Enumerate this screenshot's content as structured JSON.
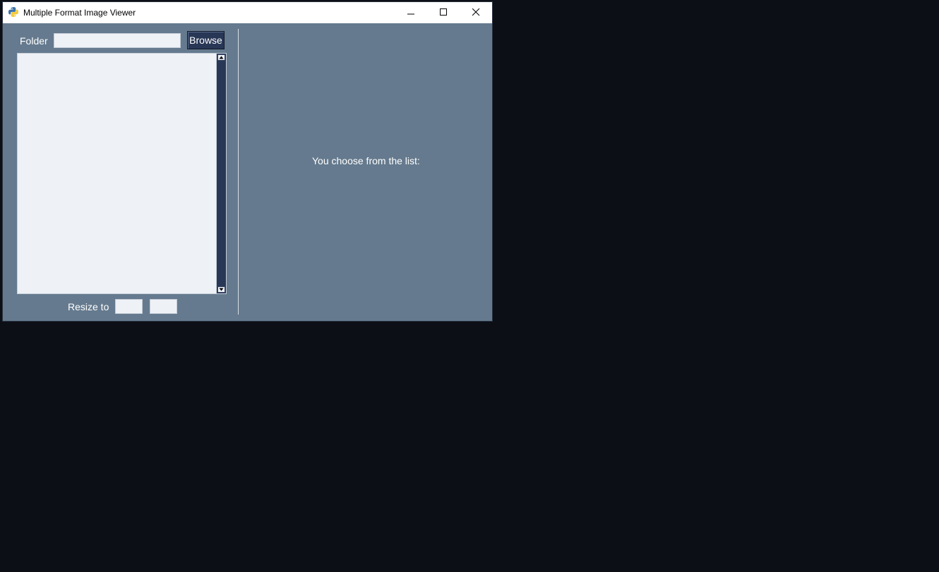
{
  "window": {
    "title": "Multiple Format Image Viewer",
    "app_icon": "python-icon",
    "controls": {
      "minimize_icon": "minimize-icon",
      "maximize_icon": "maximize-icon",
      "close_icon": "close-icon"
    }
  },
  "left_panel": {
    "folder_label": "Folder",
    "folder_input_value": "",
    "browse_label": "Browse",
    "file_list_items": [],
    "resize_label": "Resize to",
    "resize_width_value": "",
    "resize_height_value": ""
  },
  "right_panel": {
    "choose_text": "You choose from the list:"
  },
  "colors": {
    "desktop": "#0c0f16",
    "window_bg": "#657a8e",
    "button_bg": "#283756",
    "input_bg": "#eef1f6",
    "text": "#ffffff"
  }
}
